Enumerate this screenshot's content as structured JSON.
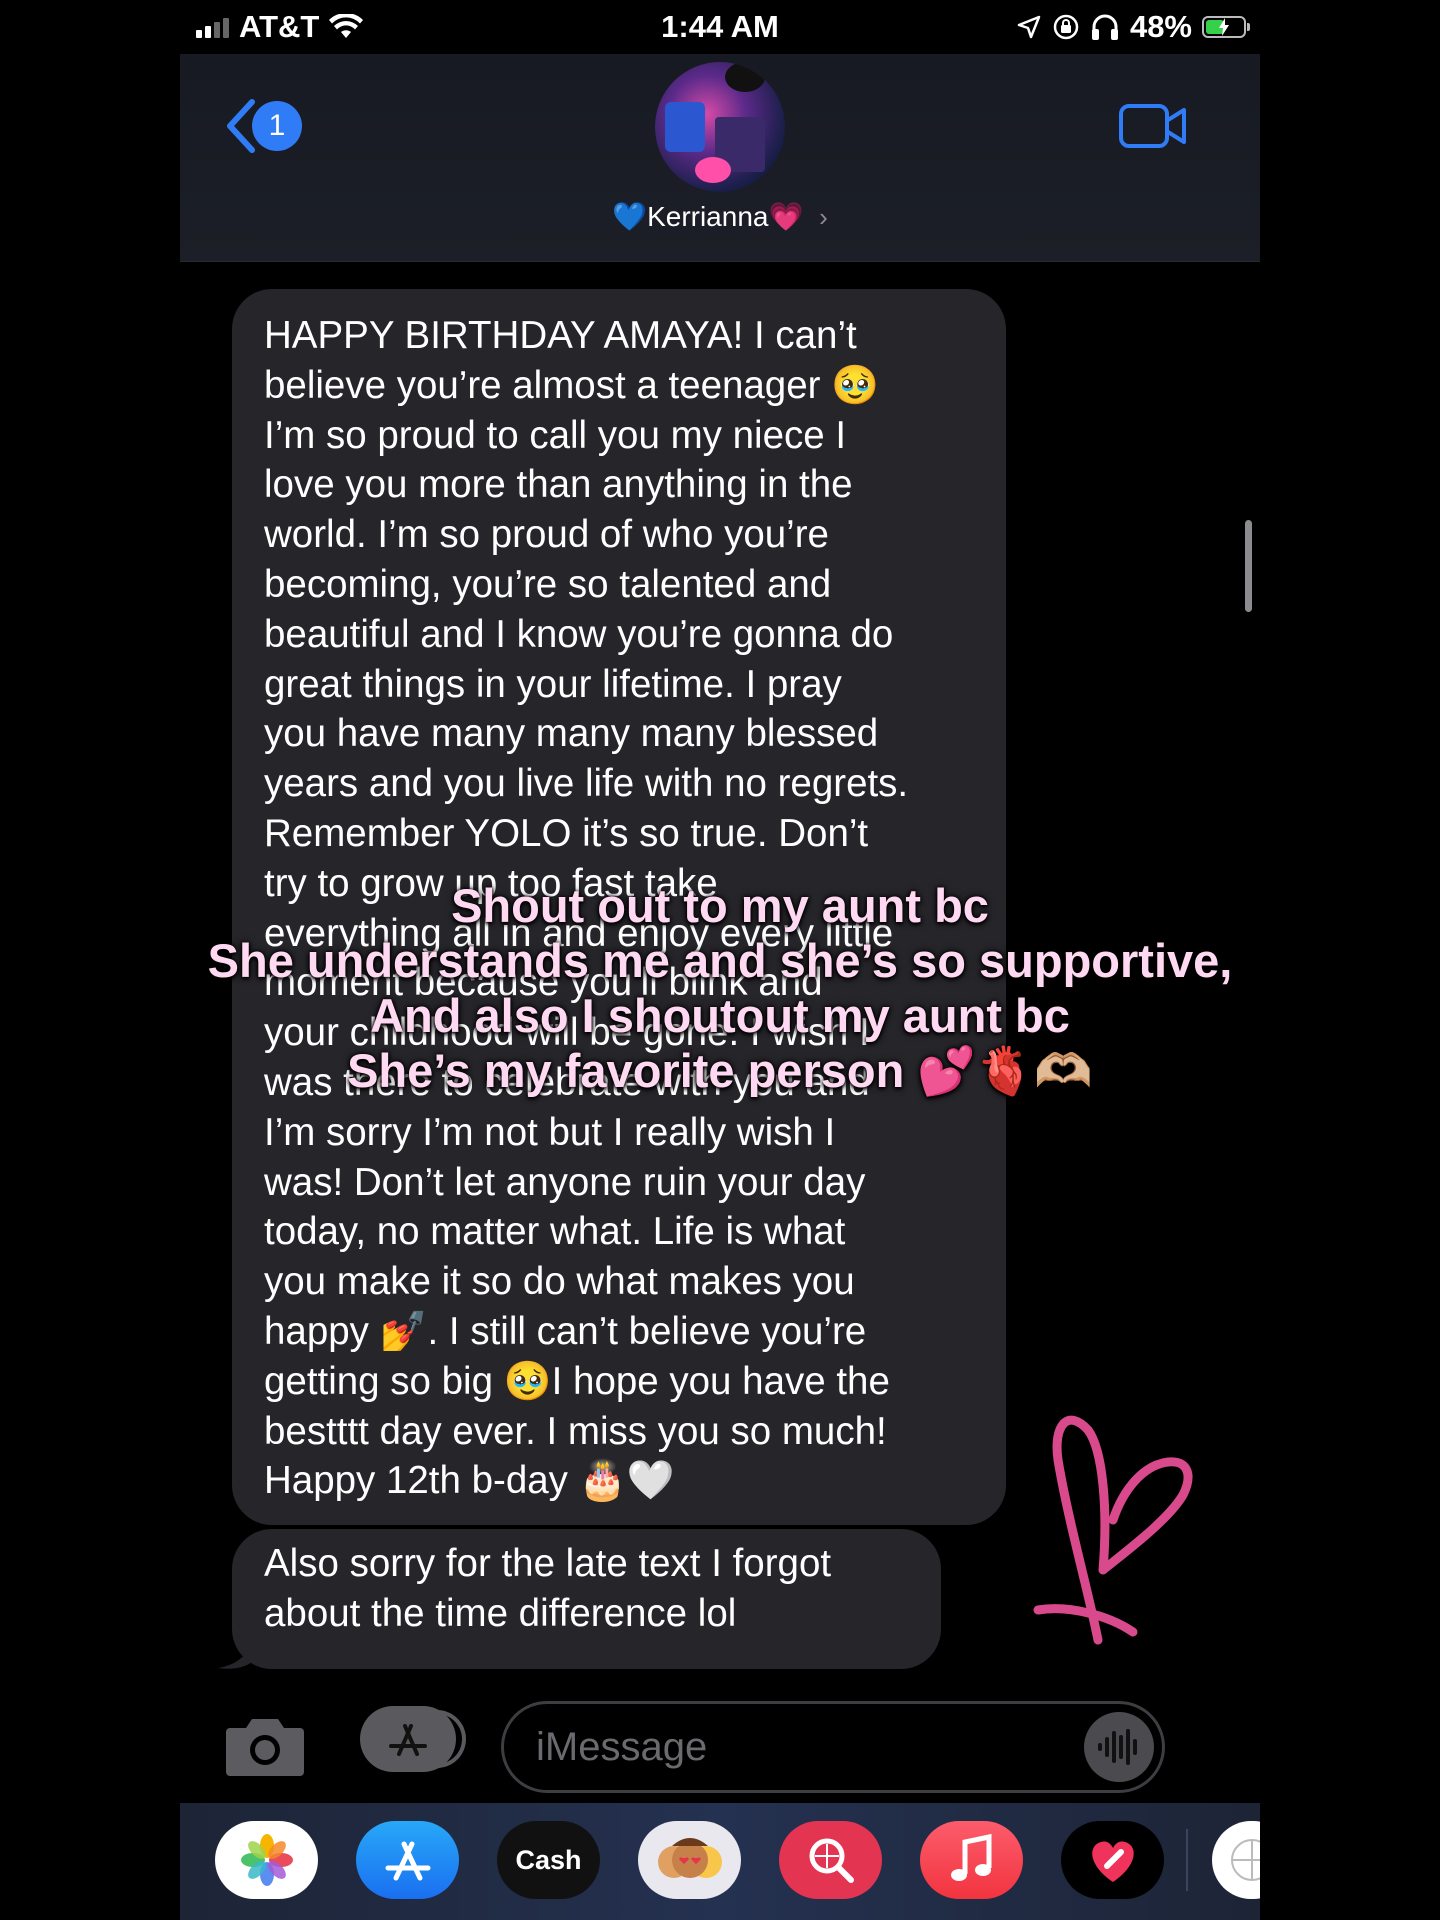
{
  "status_bar": {
    "carrier": "AT&T",
    "time": "1:44 AM",
    "battery": "48%",
    "battery_level": 0.48,
    "signal_bars": 2
  },
  "header": {
    "back_count": "1",
    "contact_name": "💙Kerrianna💗",
    "chevron": "›"
  },
  "messages": [
    {
      "sender": "received",
      "lines": [
        "HAPPY BIRTHDAY AMAYA! I can’t",
        "believe you’re almost a teenager 🥹",
        "I’m so proud to call you my niece I",
        "love you more than anything in the",
        "world. I’m so proud of who you’re",
        "becoming, you’re so talented and",
        "beautiful and I know you’re gonna do",
        "great things in your lifetime. I pray",
        "you have many many many blessed",
        "years and you live life with no regrets.",
        "Remember YOLO it’s so true. Don’t",
        "try to grow up too fast take",
        "everything all in and enjoy every little",
        "moment because you’ll blink and",
        "your childhood will be gone. I wish I",
        "was there to celebrate with you and",
        "I’m sorry I’m not but I really wish I",
        "was! Don’t let anyone ruin your day",
        "today, no matter what. Life is what",
        "you make it so do what makes you",
        "happy 💅. I still can’t believe you’re",
        "getting so big 🥹I hope you have the",
        "bestttt day ever. I miss you so much!",
        "Happy 12th b-day 🎂🤍"
      ]
    },
    {
      "sender": "received",
      "lines": [
        "Also sorry for the late text I forgot",
        "about the time difference lol"
      ]
    }
  ],
  "caption": {
    "line1": "Shout out to my aunt bc",
    "line2": "She understands me and she’s so supportive,",
    "line3": "And also I shoutout my aunt bc",
    "line4": "She’s my favorite person 💕🫀🫶🏼"
  },
  "composer": {
    "placeholder": "iMessage"
  },
  "app_tray": [
    {
      "name": "Photos",
      "icon": "photos-icon"
    },
    {
      "name": "App Store",
      "icon": "app-store-icon"
    },
    {
      "name": "Cash",
      "icon": "apple-cash-icon",
      "label": "Cash"
    },
    {
      "name": "Memoji",
      "icon": "memoji-icon"
    },
    {
      "name": "Images",
      "icon": "image-search-icon"
    },
    {
      "name": "Music",
      "icon": "music-icon"
    },
    {
      "name": "Digital Touch",
      "icon": "digital-touch-icon"
    }
  ],
  "colors": {
    "bubble": "#26252a",
    "accent_blue": "#2f7cf6",
    "caption_pink": "#ffd9f2",
    "doodle_pink": "#d94a8c"
  }
}
